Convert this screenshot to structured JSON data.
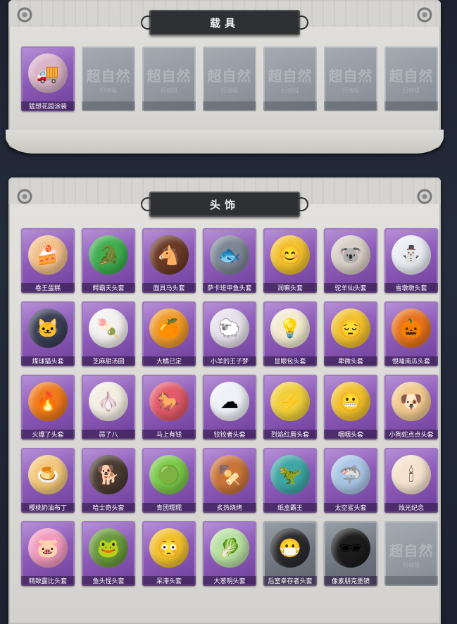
{
  "sections": {
    "vehicles": {
      "title": "载具",
      "items": [
        {
          "label": "猛想花园涂装",
          "icon": "ice-cream-truck-icon",
          "glyph": "🚚",
          "color": "#d9b3c8"
        },
        {
          "label": "",
          "empty_mark": "超自然",
          "empty_sub": "行动组"
        },
        {
          "label": "",
          "empty_mark": "超自然",
          "empty_sub": "行动组"
        },
        {
          "label": "",
          "empty_mark": "超自然",
          "empty_sub": "行动组"
        },
        {
          "label": "",
          "empty_mark": "超自然",
          "empty_sub": "行动组"
        },
        {
          "label": "",
          "empty_mark": "超自然",
          "empty_sub": "行动组"
        },
        {
          "label": "",
          "empty_mark": "超自然",
          "empty_sub": "行动组"
        }
      ]
    },
    "headwear": {
      "title": "头饰",
      "items": [
        {
          "label": "卷王蛋糕",
          "icon": "cake-roll-icon",
          "glyph": "🍰",
          "color": "#f2c08a"
        },
        {
          "label": "鳄霸天头套",
          "icon": "crocodile-icon",
          "glyph": "🐊",
          "color": "#3fae4f"
        },
        {
          "label": "面具马头套",
          "icon": "horse-icon",
          "glyph": "🐴",
          "color": "#6b3a26"
        },
        {
          "label": "萨卡班甲鱼头套",
          "icon": "fish-icon",
          "glyph": "🐟",
          "color": "#7d8794"
        },
        {
          "label": "润嘛头套",
          "icon": "smiley-icon",
          "glyph": "😊",
          "color": "#f2c12e"
        },
        {
          "label": "驼羊仙头套",
          "icon": "koala-icon",
          "glyph": "🐨",
          "color": "#d8cfc6"
        },
        {
          "label": "雪墩墩头套",
          "icon": "snowman-icon",
          "glyph": "⛄",
          "color": "#e9edf3"
        },
        {
          "label": "煤球猫头套",
          "icon": "cat-icon",
          "glyph": "🐱",
          "color": "#3a3f55"
        },
        {
          "label": "芝麻甜汤圆",
          "icon": "dumpling-icon",
          "glyph": "🍡",
          "color": "#f4f2f0"
        },
        {
          "label": "大橘已定",
          "icon": "orange-icon",
          "glyph": "🍊",
          "color": "#f09a2a"
        },
        {
          "label": "小羊的王子梦",
          "icon": "sheep-icon",
          "glyph": "🐑",
          "color": "#e6e1ea"
        },
        {
          "label": "显眼包头套",
          "icon": "light-bulb-icon",
          "glyph": "💡",
          "color": "#f3ead0"
        },
        {
          "label": "卑微头套",
          "icon": "sad-face-icon",
          "glyph": "😔",
          "color": "#f2c12e"
        },
        {
          "label": "恨嗤南瓜头套",
          "icon": "pumpkin-icon",
          "glyph": "🎃",
          "color": "#e8741e"
        },
        {
          "label": "火爆了头套",
          "icon": "fire-icon",
          "glyph": "🔥",
          "color": "#f07a1c"
        },
        {
          "label": "蒜了八",
          "icon": "garlic-icon",
          "glyph": "🧄",
          "color": "#f3eee2"
        },
        {
          "label": "马上有钱",
          "icon": "horse-cartoon-icon",
          "glyph": "🐎",
          "color": "#e25a6a"
        },
        {
          "label": "铰铰者头套",
          "icon": "cloud-icon",
          "glyph": "☁",
          "color": "#eef1f6"
        },
        {
          "label": "烈焰红唇头套",
          "icon": "pikachu-icon",
          "glyph": "⚡",
          "color": "#f1cf3a"
        },
        {
          "label": "咽咽头套",
          "icon": "grin-icon",
          "glyph": "😬",
          "color": "#f2c12e"
        },
        {
          "label": "小狗蛇点点头套",
          "icon": "dog-icon",
          "glyph": "🐶",
          "color": "#f1c98f"
        },
        {
          "label": "樱桃奶油布丁",
          "icon": "pudding-icon",
          "glyph": "🍮",
          "color": "#f3c87a"
        },
        {
          "label": "哈士奇头套",
          "icon": "husky-icon",
          "glyph": "🐕",
          "color": "#4a3b32"
        },
        {
          "label": "青团糯糯",
          "icon": "green-rice-ball-icon",
          "glyph": "🟢",
          "color": "#7ac84a"
        },
        {
          "label": "炙热烧烤",
          "icon": "barbecue-icon",
          "glyph": "🍢",
          "color": "#c9753a"
        },
        {
          "label": "纸盒霸王",
          "icon": "dinosaur-box-icon",
          "glyph": "🦖",
          "color": "#3fa6a6"
        },
        {
          "label": "太空鲨头套",
          "icon": "shark-icon",
          "glyph": "🦈",
          "color": "#a9c6e6"
        },
        {
          "label": "烛光纪念",
          "icon": "candle-icon",
          "glyph": "🕯",
          "color": "#f6e3cf"
        },
        {
          "label": "精致露比头套",
          "icon": "pink-pig-icon",
          "glyph": "🐷",
          "color": "#f29ac0"
        },
        {
          "label": "鱼头怪头套",
          "icon": "fish-monster-icon",
          "glyph": "🐸",
          "color": "#6a9a3c"
        },
        {
          "label": "呆滞头套",
          "icon": "dazed-face-icon",
          "glyph": "😳",
          "color": "#f2c12e"
        },
        {
          "label": "大葱明头套",
          "icon": "leek-icon",
          "glyph": "🥬",
          "color": "#b8e0a2"
        },
        {
          "label": "后室幸存者头套",
          "icon": "gas-mask-icon",
          "glyph": "😷",
          "color": "#2b2b2e",
          "tier": "grey"
        },
        {
          "label": "像素朋克墨镜",
          "icon": "pixel-sunglasses-icon",
          "glyph": "🕶",
          "color": "#1c1c1c",
          "tier": "grey"
        },
        {
          "label": "",
          "empty_mark": "超自然",
          "empty_sub": "行动组"
        }
      ]
    }
  }
}
